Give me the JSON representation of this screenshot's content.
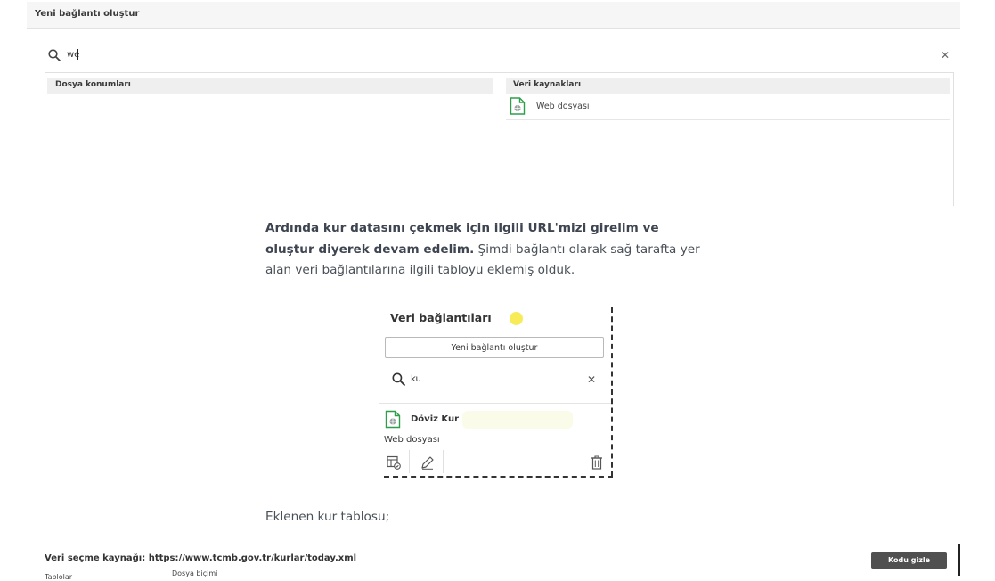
{
  "dialog": {
    "title": "Yeni bağlantı oluştur",
    "search": {
      "value": "we",
      "icon": "search-icon",
      "clear_icon": "close-icon"
    },
    "columns": {
      "file_locations": {
        "label": "Dosya konumları"
      },
      "data_sources": {
        "label": "Veri kaynakları",
        "items": [
          {
            "label": "Web dosyası",
            "icon": "web-file-icon"
          }
        ]
      }
    }
  },
  "article": {
    "paragraph_bold": "Ardında kur datasını çekmek için ilgili URL'mizi girelim ve oluştur diyerek devam edelim.",
    "paragraph_rest": " Şimdi bağlantı olarak sağ tarafta yer alan veri bağlantılarına ilgili tabloyu eklemiş olduk.",
    "caption": "Eklenen kur tablosu;"
  },
  "connections_panel": {
    "title": "Veri bağlantıları",
    "new_button_label": "Yeni bağlantı oluştur",
    "search": {
      "value": "ku",
      "icon": "search-icon",
      "clear_icon": "close-icon"
    },
    "items": [
      {
        "name": "Döviz Kur",
        "type": "Web dosyası",
        "icon": "web-file-icon",
        "actions": [
          "select-data-icon",
          "edit-icon",
          "delete-icon"
        ]
      }
    ],
    "accent_color": "#f7ec57",
    "icon_green": "#2e9e4a"
  },
  "bottom_strip": {
    "source_label": "Veri seçme kaynağı: https://www.tcmb.gov.tr/kurlar/today.xml",
    "hide_code_button": "Kodu gizle",
    "cut_text_left": "Tablolar",
    "cut_text_right": "Dosya biçimi",
    "button_color": "#505050"
  }
}
